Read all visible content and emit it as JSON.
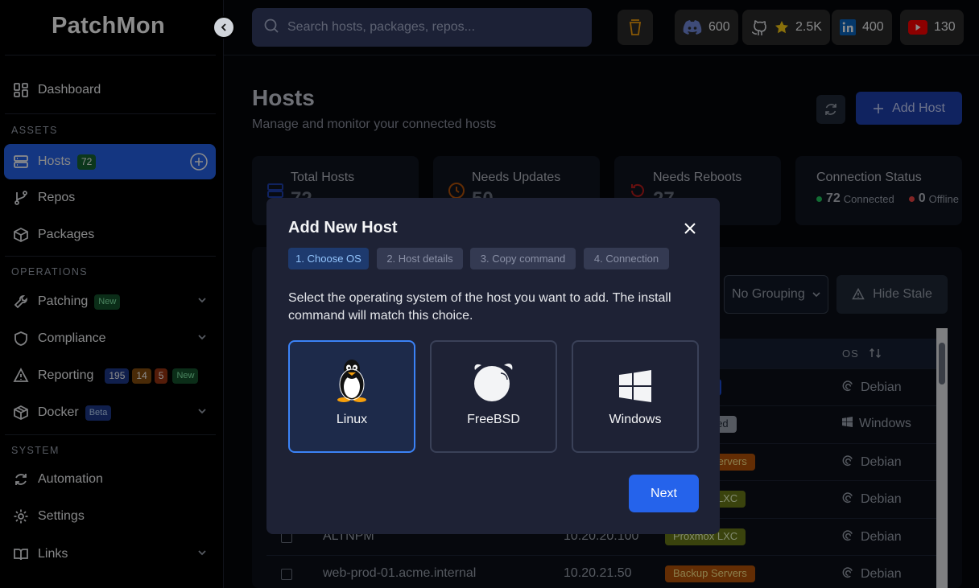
{
  "brand": {
    "name": "PatchMon"
  },
  "search": {
    "placeholder": "Search hosts, packages, repos..."
  },
  "social": {
    "discord": "600",
    "github": "2.5K",
    "linkedin": "400",
    "youtube": "130"
  },
  "sidebar": {
    "dashboard": "Dashboard",
    "assets_label": "ASSETS",
    "hosts": {
      "label": "Hosts",
      "count": "72"
    },
    "repos": "Repos",
    "packages": "Packages",
    "operations_label": "OPERATIONS",
    "patching": {
      "label": "Patching",
      "badge": "New"
    },
    "compliance": "Compliance",
    "reporting": {
      "label": "Reporting",
      "c1": "195",
      "c2": "14",
      "c3": "5",
      "badge": "New"
    },
    "docker": {
      "label": "Docker",
      "badge": "Beta"
    },
    "system_label": "SYSTEM",
    "automation": "Automation",
    "settings": "Settings",
    "links": "Links"
  },
  "page": {
    "title": "Hosts",
    "subtitle": "Manage and monitor your connected hosts",
    "add_host": "Add Host"
  },
  "stats": {
    "total": {
      "label": "Total Hosts",
      "value": "72"
    },
    "updates": {
      "label": "Needs Updates",
      "value": "50"
    },
    "reboots": {
      "label": "Needs Reboots",
      "value": "27"
    },
    "connection": {
      "label": "Connection Status",
      "connected_count": "72",
      "connected_label": "Connected",
      "offline_count": "0",
      "offline_label": "Offline"
    }
  },
  "toolbar": {
    "grouping": "No Grouping",
    "hide_stale": "Hide Stale"
  },
  "table": {
    "os_header": "OS",
    "rows": [
      {
        "host": "",
        "ip": "",
        "group": "Systems",
        "os": "Debian"
      },
      {
        "host": "",
        "ip": "",
        "group": "Unassigned",
        "os": "Windows"
      },
      {
        "host": "",
        "ip": "",
        "group": "Backup Servers",
        "os": "Debian"
      },
      {
        "host": "",
        "ip": "",
        "group": "Proxmox LXC",
        "os": "Debian"
      },
      {
        "host": "ALTNPM",
        "ip": "10.20.20.100",
        "group": "Proxmox LXC",
        "os": "Debian"
      },
      {
        "host": "web-prod-01.acme.internal",
        "ip": "10.20.21.50",
        "group": "Backup Servers",
        "os": "Debian"
      }
    ]
  },
  "modal": {
    "title": "Add New Host",
    "steps": [
      "1. Choose OS",
      "2. Host details",
      "3. Copy command",
      "4. Connection"
    ],
    "description": "Select the operating system of the host you want to add. The install command will match this choice.",
    "options": [
      "Linux",
      "FreeBSD",
      "Windows"
    ],
    "selected": "Linux",
    "next": "Next"
  },
  "colors": {
    "accent": "#2563eb",
    "modal_bg": "#1e2235",
    "sidebar_bg": "#000000"
  }
}
